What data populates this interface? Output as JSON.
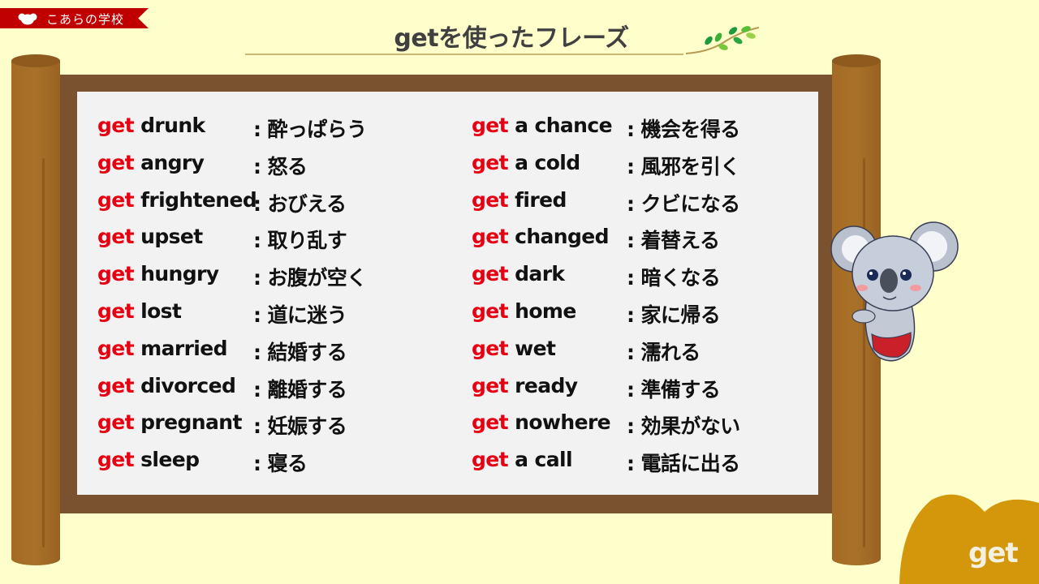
{
  "header": {
    "brand": "こあらの学校",
    "title": "getを使ったフレーズ"
  },
  "colors": {
    "background": "#ffffcc",
    "ribbon": "#c00000",
    "verb": "#e60012",
    "frame": "#7b5230",
    "post": "#a56b25",
    "panel": "#f2f2f2",
    "badge": "#d4960a"
  },
  "phrases": {
    "left": [
      {
        "verb": "get",
        "phrase": "drunk",
        "meaning": ": 酔っぱらう"
      },
      {
        "verb": "get",
        "phrase": "angry",
        "meaning": ": 怒る"
      },
      {
        "verb": "get",
        "phrase": "frightened",
        "meaning": ": おびえる"
      },
      {
        "verb": "get",
        "phrase": "upset",
        "meaning": ": 取り乱す"
      },
      {
        "verb": "get",
        "phrase": "hungry",
        "meaning": ": お腹が空く"
      },
      {
        "verb": "get",
        "phrase": "lost",
        "meaning": ": 道に迷う"
      },
      {
        "verb": "get",
        "phrase": "married",
        "meaning": ": 結婚する"
      },
      {
        "verb": "get",
        "phrase": "divorced",
        "meaning": ": 離婚する"
      },
      {
        "verb": "get",
        "phrase": "pregnant",
        "meaning": ": 妊娠する"
      },
      {
        "verb": "get",
        "phrase": "sleep",
        "meaning": ": 寝る"
      }
    ],
    "right": [
      {
        "verb": "get",
        "phrase": "a chance",
        "meaning": ": 機会を得る"
      },
      {
        "verb": "get",
        "phrase": "a cold",
        "meaning": ": 風邪を引く"
      },
      {
        "verb": "get",
        "phrase": "fired",
        "meaning": ": クビになる"
      },
      {
        "verb": "get",
        "phrase": "changed",
        "meaning": ": 着替える"
      },
      {
        "verb": "get",
        "phrase": "dark",
        "meaning": ": 暗くなる"
      },
      {
        "verb": "get",
        "phrase": "home",
        "meaning": ": 家に帰る"
      },
      {
        "verb": "get",
        "phrase": "wet",
        "meaning": ": 濡れる"
      },
      {
        "verb": "get",
        "phrase": "ready",
        "meaning": ": 準備する"
      },
      {
        "verb": "get",
        "phrase": "nowhere",
        "meaning": ": 効果がない"
      },
      {
        "verb": "get",
        "phrase": "a call",
        "meaning": ": 電話に出る"
      }
    ]
  },
  "badge": {
    "label": "get"
  },
  "icons": {
    "logo": "koala-head-icon",
    "branch": "leaf-branch-icon",
    "mascot": "koala-mascot"
  }
}
